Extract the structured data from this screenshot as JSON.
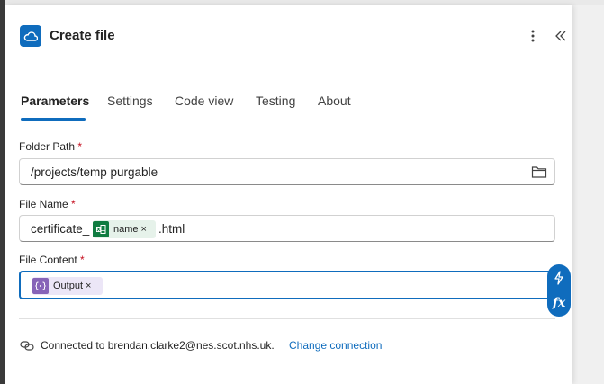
{
  "header": {
    "title": "Create file",
    "app_icon": "onedrive-cloud-icon",
    "accent": "#0f6cbd"
  },
  "tabs": [
    {
      "label": "Parameters",
      "active": true
    },
    {
      "label": "Settings",
      "active": false
    },
    {
      "label": "Code view",
      "active": false
    },
    {
      "label": "Testing",
      "active": false
    },
    {
      "label": "About",
      "active": false
    }
  ],
  "fields": {
    "folder_path": {
      "label": "Folder Path",
      "required": "*",
      "value": "/projects/temp purgable"
    },
    "file_name": {
      "label": "File Name",
      "required": "*",
      "prefix": "certificate_",
      "token": "name",
      "token_close": "×",
      "suffix": ".html"
    },
    "file_content": {
      "label": "File Content",
      "required": "*",
      "token": "Output",
      "token_close": "×"
    }
  },
  "side_buttons": {
    "dynamic_content_icon": "lightning-icon",
    "expression_label": "fx"
  },
  "connection": {
    "text": "Connected to brendan.clarke2@nes.scot.nhs.uk.",
    "change_label": "Change connection"
  }
}
